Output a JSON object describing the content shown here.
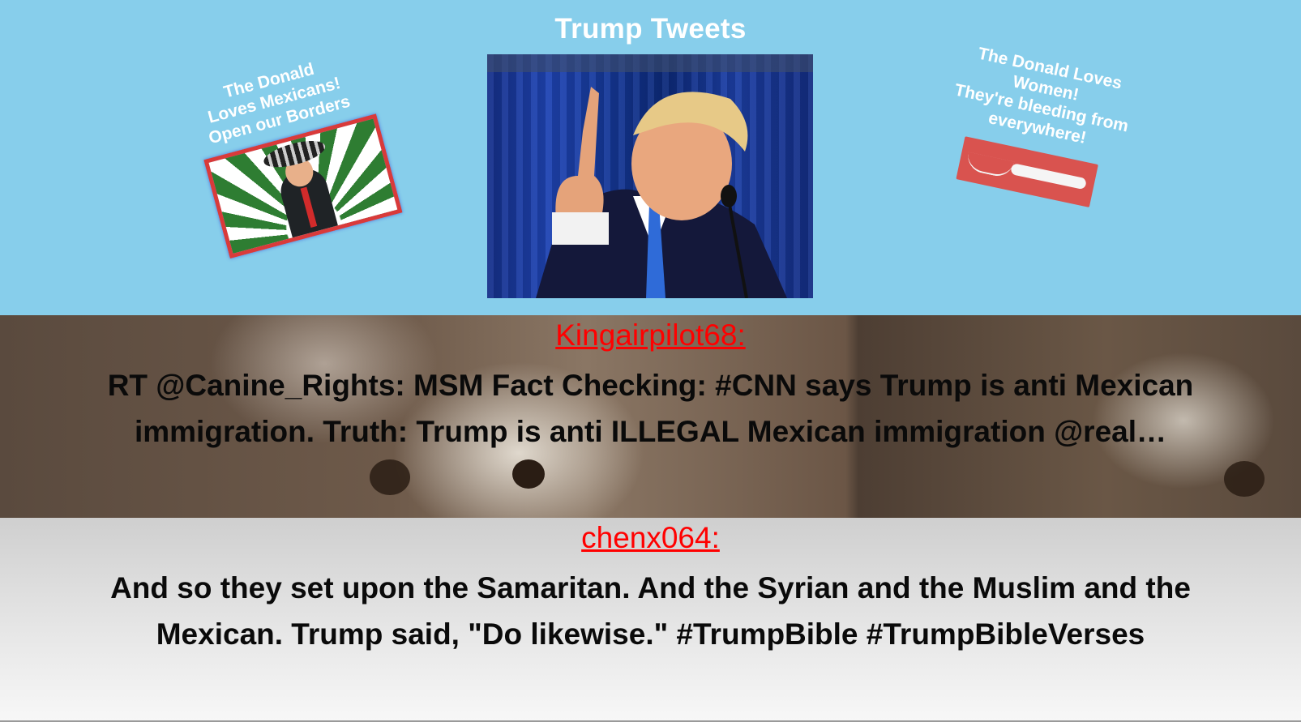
{
  "header": {
    "title": "Trump Tweets",
    "left_card_caption": [
      "The Donald",
      "Loves Mexicans!",
      "Open our Borders"
    ],
    "right_card_caption": [
      "The Donald Loves",
      "Women!",
      "They're bleeding from",
      "everywhere!"
    ]
  },
  "tweets": [
    {
      "user": "Kingairpilot68:",
      "text": "RT @Canine_Rights: MSM Fact Checking: #CNN says Trump is anti Mexican immigration. Truth: Trump is anti ILLEGAL Mexican immigration @real…"
    },
    {
      "user": "chenx064:",
      "text": "And so they set upon the Samaritan. And the Syrian and the Muslim and the Mexican. Trump said, \"Do likewise.\" #TrumpBible #TrumpBibleVerses"
    }
  ],
  "colors": {
    "header_bg": "#87ceeb",
    "username": "#ff0000",
    "card_border": "#d93a3a",
    "pad": "#d9534f"
  }
}
